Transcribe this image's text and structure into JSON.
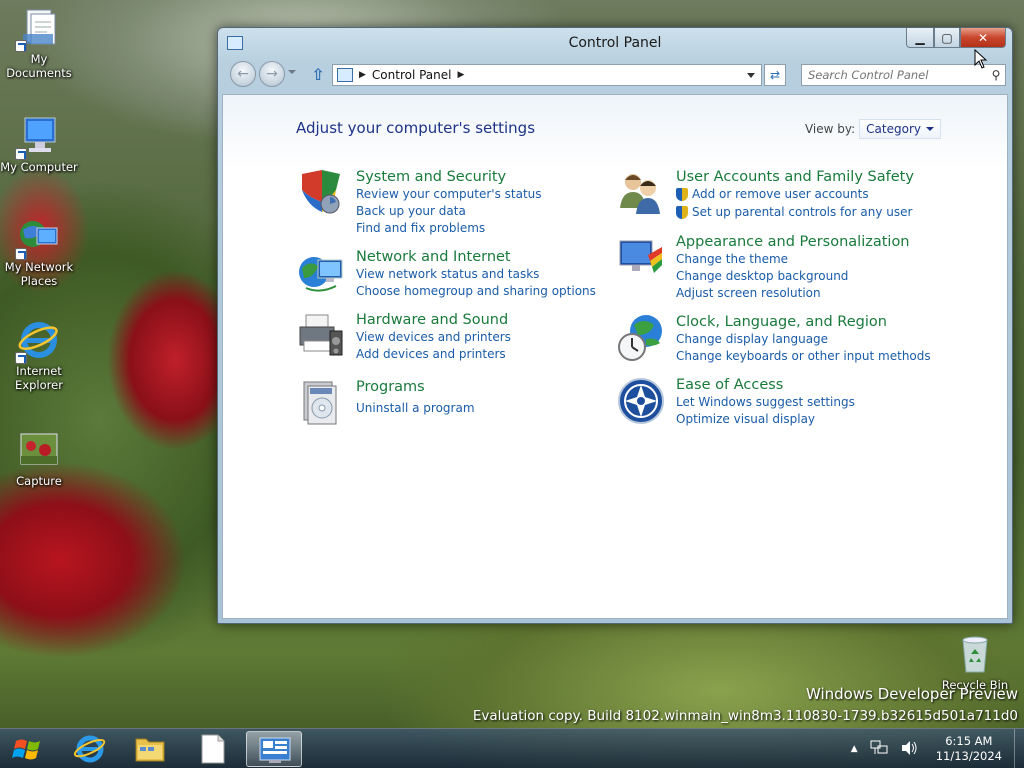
{
  "desktop": {
    "icons": [
      {
        "label": "My Documents"
      },
      {
        "label": "My Computer"
      },
      {
        "label": "My Network Places"
      },
      {
        "label": "Internet Explorer"
      },
      {
        "label": "Capture"
      },
      {
        "label": "Recycle Bin"
      }
    ],
    "watermark": {
      "line1": "Windows Developer Preview",
      "line2": "Evaluation copy. Build 8102.winmain_win8m3.110830-1739.b32615d501a711d0"
    }
  },
  "window": {
    "title": "Control Panel",
    "buttons": {
      "minimize": "▁",
      "maximize": "▢",
      "close": "✕"
    },
    "address": {
      "crumb": "Control Panel"
    },
    "search": {
      "placeholder": "Search Control Panel"
    },
    "heading": "Adjust your computer's settings",
    "view_by": {
      "label": "View by:",
      "value": "Category"
    },
    "categories_left": [
      {
        "title": "System and Security",
        "links": [
          "Review your computer's status",
          "Back up your data",
          "Find and fix problems"
        ]
      },
      {
        "title": "Network and Internet",
        "links": [
          "View network status and tasks",
          "Choose homegroup and sharing options"
        ]
      },
      {
        "title": "Hardware and Sound",
        "links": [
          "View devices and printers",
          "Add devices and printers"
        ]
      },
      {
        "title": "Programs",
        "links": [
          "Uninstall a program"
        ]
      }
    ],
    "categories_right": [
      {
        "title": "User Accounts and Family Safety",
        "links": [
          "Add or remove user accounts",
          "Set up parental controls for any user"
        ]
      },
      {
        "title": "Appearance and Personalization",
        "links": [
          "Change the theme",
          "Change desktop background",
          "Adjust screen resolution"
        ]
      },
      {
        "title": "Clock, Language, and Region",
        "links": [
          "Change display language",
          "Change keyboards or other input methods"
        ]
      },
      {
        "title": "Ease of Access",
        "links": [
          "Let Windows suggest settings",
          "Optimize visual display"
        ]
      }
    ]
  },
  "taskbar": {
    "clock": {
      "time": "6:15 AM",
      "date": "11/13/2024"
    },
    "tray": {
      "expand": "▲"
    }
  }
}
